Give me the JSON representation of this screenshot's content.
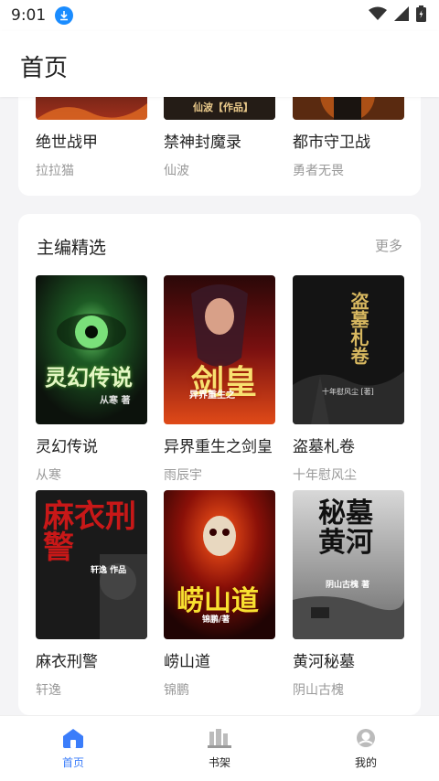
{
  "status": {
    "time": "9:01"
  },
  "header": {
    "title": "首页"
  },
  "top_section": {
    "books": [
      {
        "title": "绝世战甲",
        "author": "拉拉猫"
      },
      {
        "title": "禁神封魔录",
        "author": "仙波"
      },
      {
        "title": "都市守卫战",
        "author": "勇者无畏"
      }
    ],
    "cover_fragment_text": "仙波【作品】"
  },
  "editor_section": {
    "title": "主编精选",
    "more": "更多",
    "books": [
      {
        "title": "灵幻传说",
        "author": "从寒",
        "cover_text": "灵幻传说",
        "cover_sub": "从寒 著"
      },
      {
        "title": "异界重生之剑皇",
        "author": "雨辰宇",
        "cover_text": "剑皇",
        "cover_sub": "异界重生之"
      },
      {
        "title": "盗墓札卷",
        "author": "十年慰风尘",
        "cover_text": "盗墓札卷",
        "cover_sub": "十年慰风尘 [著]"
      },
      {
        "title": "麻衣刑警",
        "author": "轩逸",
        "cover_text": "麻衣刑警",
        "cover_sub": "轩逸 作品"
      },
      {
        "title": "崂山道",
        "author": "锦鹏",
        "cover_text": "崂山道",
        "cover_sub": "锦鹏/著"
      },
      {
        "title": "黄河秘墓",
        "author": "阴山古槐",
        "cover_text": "秘墓 黄河",
        "cover_sub": "阴山古槐 著"
      }
    ]
  },
  "tabbar": {
    "items": [
      {
        "label": "首页",
        "icon": "home-icon"
      },
      {
        "label": "书架",
        "icon": "bookshelf-icon"
      },
      {
        "label": "我的",
        "icon": "profile-icon"
      }
    ]
  },
  "colors": {
    "accent": "#3b7dfa",
    "download_badge": "#1a8cff"
  }
}
